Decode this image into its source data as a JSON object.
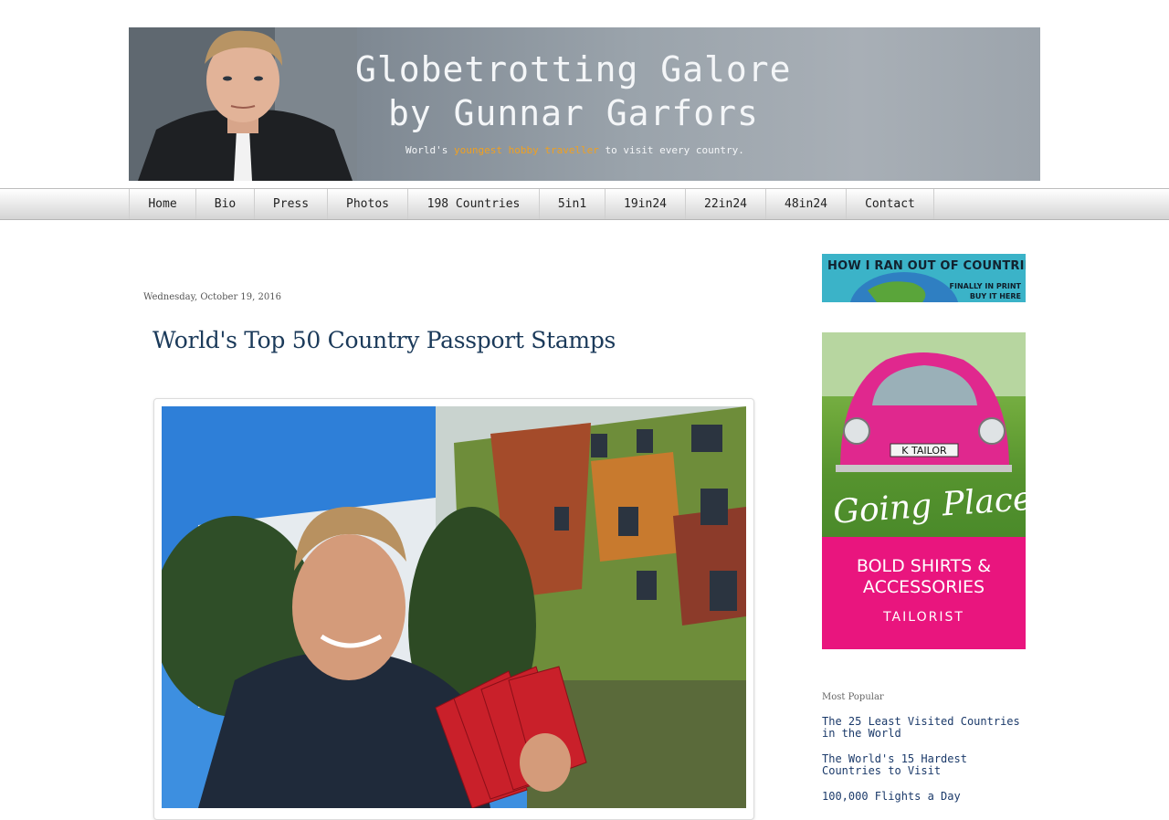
{
  "banner": {
    "title_line1": "Globetrotting Galore",
    "title_line2": "by Gunnar Garfors",
    "tagline_pre": "World's ",
    "tagline_highlight": "youngest hobby traveller",
    "tagline_post": " to visit every country."
  },
  "nav": [
    {
      "label": "Home"
    },
    {
      "label": "Bio"
    },
    {
      "label": "Press"
    },
    {
      "label": "Photos"
    },
    {
      "label": "198 Countries"
    },
    {
      "label": "5in1"
    },
    {
      "label": "19in24"
    },
    {
      "label": "22in24"
    },
    {
      "label": "48in24"
    },
    {
      "label": "Contact"
    }
  ],
  "post": {
    "date": "Wednesday, October 19, 2016",
    "title": "World's Top 50 Country Passport Stamps"
  },
  "sidebar": {
    "ad1": {
      "line1": "HOW I RAN OUT OF COUNTRIES",
      "line2a": "FINALLY IN PRINT",
      "line2b": "BUY IT HERE"
    },
    "ad2": {
      "plate": "K TAILOR",
      "script": "Going Places?",
      "bold1": "BOLD SHIRTS &",
      "bold2": "ACCESSORIES",
      "brand": "TAILORIST"
    },
    "most_popular_title": "Most Popular",
    "most_popular": [
      {
        "title": "The 25 Least Visited Countries in the World"
      },
      {
        "title": "The World's 15 Hardest Countries to Visit"
      },
      {
        "title": "100,000 Flights a Day"
      }
    ]
  }
}
